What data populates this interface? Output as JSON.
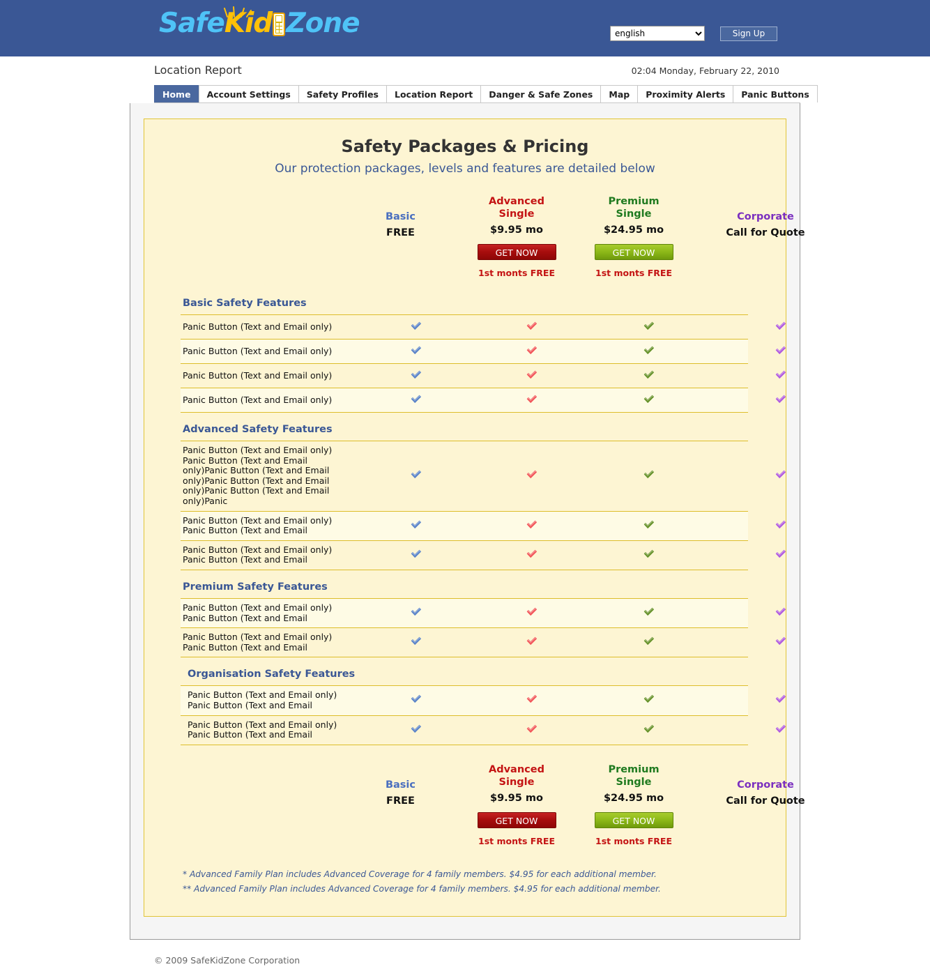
{
  "header": {
    "logo": {
      "part1": "Safe",
      "part2": "Kid",
      "part3": "Zone",
      "icon": "cellphone-icon"
    },
    "language_selected": "english",
    "signup_label": "Sign Up"
  },
  "page": {
    "title": "Location Report",
    "timestamp": "02:04 Monday, February 22, 2010"
  },
  "tabs": [
    {
      "label": "Home",
      "active": true
    },
    {
      "label": "Account Settings",
      "active": false
    },
    {
      "label": "Safety Profiles",
      "active": false
    },
    {
      "label": "Location Report",
      "active": false
    },
    {
      "label": "Danger & Safe Zones",
      "active": false
    },
    {
      "label": "Map",
      "active": false
    },
    {
      "label": "Proximity Alerts",
      "active": false
    },
    {
      "label": "Panic Buttons",
      "active": false
    }
  ],
  "panel": {
    "title": "Safety Packages & Pricing",
    "subtitle": "Our protection packages, levels and features are detailed below"
  },
  "plans": [
    {
      "name": "Basic",
      "price": "FREE",
      "color": "#4a6fbf",
      "button": null,
      "promo": null
    },
    {
      "name_line1": "Advanced",
      "name_line2": "Single",
      "price": "$9.95 mo",
      "color": "#c41414",
      "button": "GET NOW",
      "promo": "1st monts FREE"
    },
    {
      "name_line1": "Premium",
      "name_line2": "Single",
      "price": "$24.95 mo",
      "color": "#1f7a1f",
      "button": "GET NOW",
      "promo": "1st monts FREE"
    },
    {
      "name": "Corporate",
      "price": "Call for Quote",
      "color": "#7b2fbf",
      "button": null,
      "promo": null
    }
  ],
  "check_colors": {
    "basic": "#5b84c9",
    "advanced": "#f2565a",
    "premium": "#66922a",
    "corporate": "#b05ae0"
  },
  "sections": [
    {
      "heading": "Basic Safety Features",
      "indent": false,
      "rows": [
        {
          "label": "Panic Button (Text and Email only)"
        },
        {
          "label": "Panic Button (Text and Email only)"
        },
        {
          "label": "Panic Button (Text and Email only)"
        },
        {
          "label": "Panic Button (Text and Email only)"
        }
      ]
    },
    {
      "heading": "Advanced Safety Features",
      "indent": false,
      "rows": [
        {
          "label": "Panic Button (Text and Email only) Panic Button (Text and Email only)Panic Button (Text and Email only)Panic Button (Text and Email only)Panic Button (Text and Email only)Panic"
        },
        {
          "label": "Panic Button (Text and Email only) Panic Button (Text and Email"
        },
        {
          "label": "Panic Button (Text and Email only) Panic Button (Text and Email"
        }
      ]
    },
    {
      "heading": "Premium Safety Features",
      "indent": false,
      "rows": [
        {
          "label": "Panic Button (Text and Email only) Panic Button (Text and Email"
        },
        {
          "label": "Panic Button (Text and Email only) Panic Button (Text and Email"
        }
      ]
    },
    {
      "heading": "Organisation Safety Features",
      "indent": true,
      "rows": [
        {
          "label": "Panic Button (Text and Email only) Panic Button (Text and Email"
        },
        {
          "label": "Panic Button (Text and Email only) Panic Button (Text and Email"
        }
      ]
    }
  ],
  "notes": [
    "* Advanced Family Plan includes Advanced Coverage for 4 family members. $4.95 for each additional member.",
    "** Advanced Family Plan includes Advanced Coverage for 4 family members. $4.95 for each additional member."
  ],
  "footer": {
    "copyright": "© 2009 SafeKidZone Corporation"
  },
  "colors": {
    "header_blue": "#3a5795",
    "panel_bg": "#fdf5d3",
    "panel_border": "#e0c437",
    "row_border": "#ddbd2a",
    "container_bg": "#f5f5f5"
  }
}
